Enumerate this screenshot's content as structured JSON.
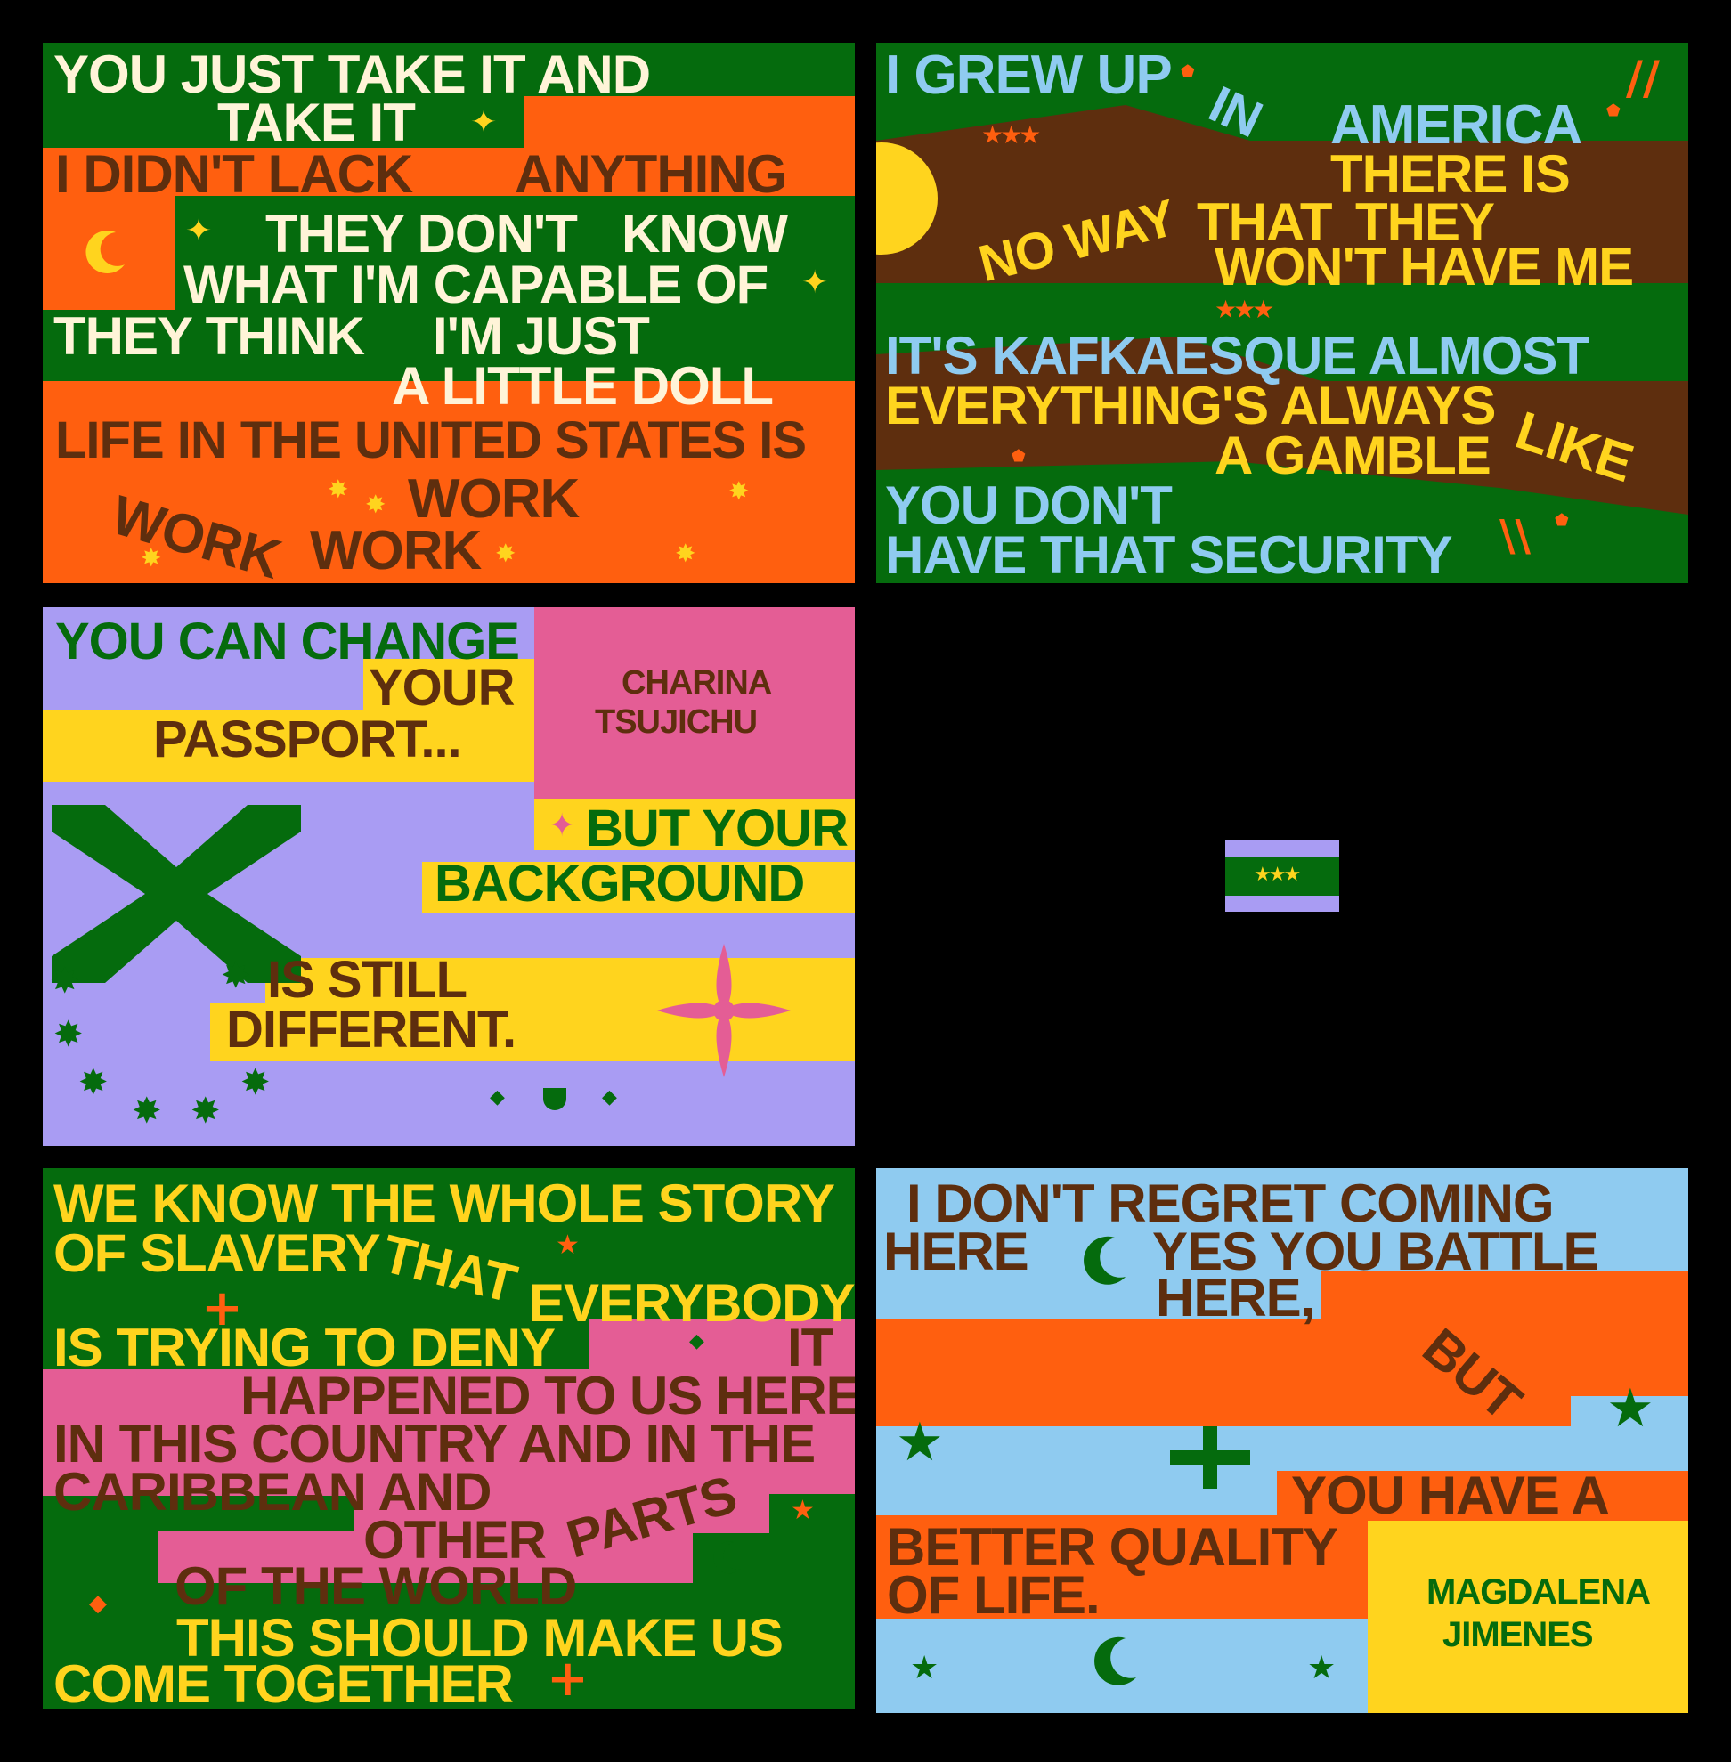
{
  "colors": {
    "green": "#056B0D",
    "orange": "#FF5F0F",
    "brown": "#5E2E0E",
    "yellow": "#FFD41E",
    "cream": "#FFF4D8",
    "sky": "#8FCBF0",
    "lavender": "#A99CF3",
    "pink": "#E45D95",
    "black": "#000000"
  },
  "flag1": {
    "lines": [
      "YOU JUST  TAKE IT AND",
      "TAKE IT",
      "I DIDN'T LACK",
      "ANYTHING",
      "THEY DON'T",
      "KNOW",
      "WHAT I'M CAPABLE OF",
      "THEY THINK",
      "I'M JUST",
      "A LITTLE DOLL",
      "LIFE IN THE UNITED STATES IS",
      "WORK",
      "WORK",
      "WORK"
    ]
  },
  "flag2": {
    "lines": [
      "I GREW UP",
      "IN",
      "AMERICA",
      "THERE IS",
      "NO WAY",
      "THAT",
      "THEY",
      "WON'T HAVE ME",
      "IT'S KAFKAESQUE ALMOST",
      "EVERYTHING'S ALWAYS",
      "LIKE",
      "A GAMBLE",
      "YOU  DON'T",
      "HAVE THAT SECURITY"
    ]
  },
  "flag3": {
    "lines": [
      "YOU CAN CHANGE",
      "YOUR",
      "PASSPORT...",
      "BUT YOUR",
      "BACKGROUND",
      "IS STILL",
      "DIFFERENT."
    ],
    "name": [
      "CHARINA",
      "TSUJICHU"
    ]
  },
  "flag4": {
    "lines": [
      "WE KNOW  THE WHOLE  STORY",
      "OF SLAVERY",
      "THAT",
      "EVERYBODY",
      "IS TRYING  TO DENY",
      "IT",
      "HAPPENED TO US HERE",
      "IN THIS COUNTRY  AND  IN THE",
      "CARIBBEAN AND",
      "OTHER",
      "PARTS",
      "OF THE WORLD",
      "THIS    SHOULD  MAKE US",
      "COME TOGETHER"
    ]
  },
  "flag5": {
    "lines": [
      "I  DON'T    REGRET   COMING",
      "HERE",
      "YES  YOU  BATTLE",
      "HERE,",
      "BUT",
      "YOU  HAVE  A",
      "BETTER QUALITY",
      "OF LIFE."
    ],
    "name": [
      "MAGDALENA",
      "JIMENES"
    ]
  },
  "icons": [
    "sparkle-icon",
    "moon-icon",
    "star-icon",
    "sun-icon",
    "three-stars-icon",
    "cross-icon",
    "x-cross-icon",
    "flower-icon",
    "pentagon-icon",
    "diamond-icon",
    "plus-icon",
    "double-slash-icon"
  ]
}
